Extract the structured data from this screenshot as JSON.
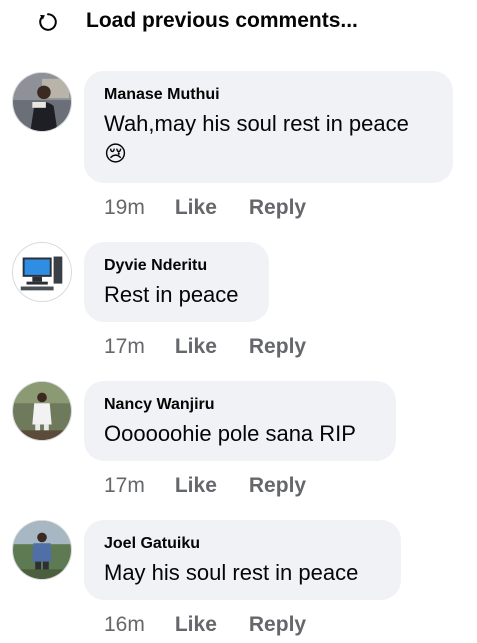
{
  "header": {
    "load_previous_label": "Load previous comments...",
    "load_icon": "refresh-icon"
  },
  "comments": [
    {
      "author": "Manase Muthui",
      "text": "Wah,may his soul rest in peace",
      "emoji": "😢",
      "time": "19m",
      "like_label": "Like",
      "reply_label": "Reply"
    },
    {
      "author": "Dyvie Nderitu",
      "text": "Rest in peace",
      "time": "17m",
      "like_label": "Like",
      "reply_label": "Reply"
    },
    {
      "author": "Nancy Wanjiru",
      "text": "Oooooohie pole sana RIP",
      "time": "17m",
      "like_label": "Like",
      "reply_label": "Reply"
    },
    {
      "author": "Joel Gatuiku",
      "text": "May his soul rest in peace",
      "time": "16m",
      "like_label": "Like",
      "reply_label": "Reply"
    }
  ],
  "colors": {
    "bubble_bg": "#f0f2f5",
    "text_primary": "#050505",
    "text_secondary": "#65676b"
  }
}
